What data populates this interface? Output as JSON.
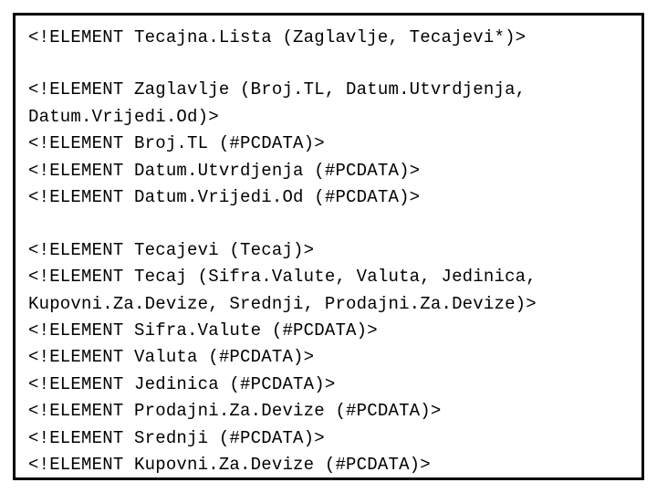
{
  "dtd": {
    "lines": [
      "<!ELEMENT Tecajna.Lista (Zaglavlje, Tecajevi*)>",
      "",
      "<!ELEMENT Zaglavlje (Broj.TL, Datum.Utvrdjenja, Datum.Vrijedi.Od)>",
      "<!ELEMENT Broj.TL (#PCDATA)>",
      "<!ELEMENT Datum.Utvrdjenja (#PCDATA)>",
      "<!ELEMENT Datum.Vrijedi.Od (#PCDATA)>",
      "",
      "<!ELEMENT Tecajevi (Tecaj)>",
      "<!ELEMENT Tecaj (Sifra.Valute, Valuta, Jedinica, Kupovni.Za.Devize, Srednji, Prodajni.Za.Devize)>",
      "<!ELEMENT Sifra.Valute (#PCDATA)>",
      "<!ELEMENT Valuta (#PCDATA)>",
      "<!ELEMENT Jedinica (#PCDATA)>",
      "<!ELEMENT Prodajni.Za.Devize (#PCDATA)>",
      "<!ELEMENT Srednji (#PCDATA)>",
      "<!ELEMENT Kupovni.Za.Devize (#PCDATA)>"
    ]
  }
}
